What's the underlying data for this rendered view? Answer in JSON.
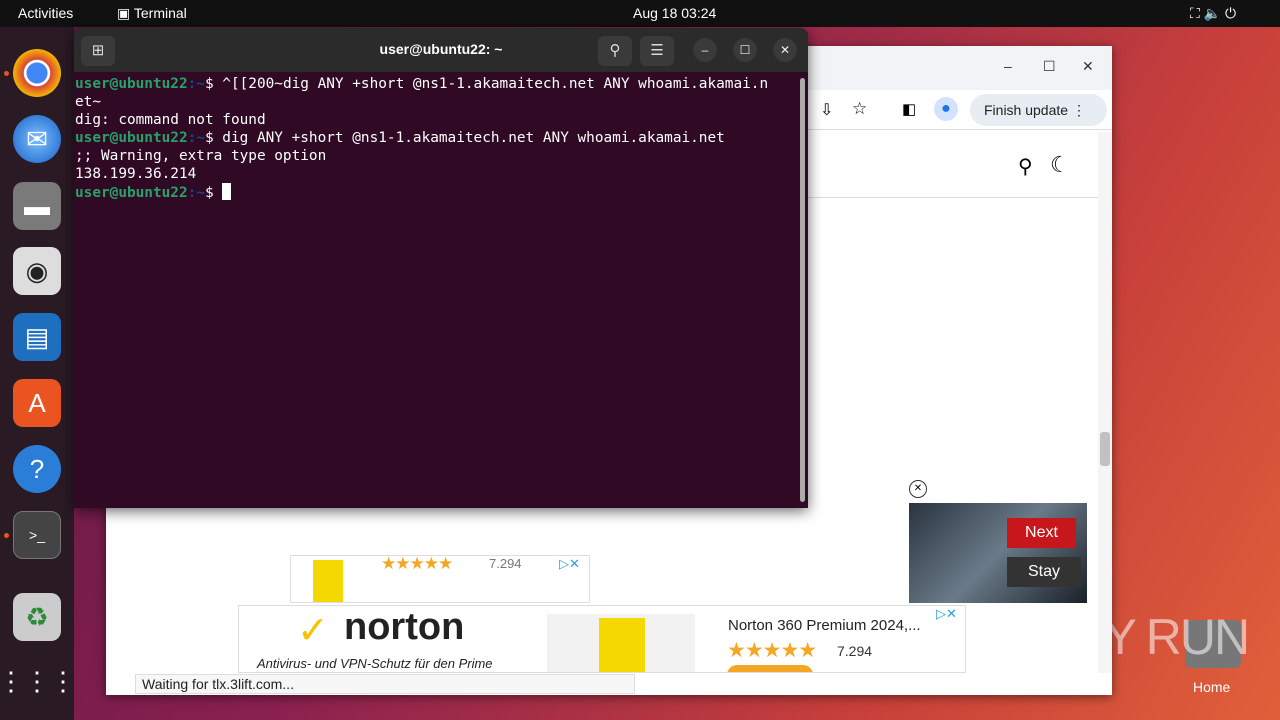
{
  "topbar": {
    "activities": "Activities",
    "app": "Terminal",
    "datetime": "Aug 18  03:24"
  },
  "dock": {
    "items": [
      "chrome-icon",
      "thunderbird-icon",
      "files-icon",
      "rhythmbox-icon",
      "writer-icon",
      "software-icon",
      "help-icon",
      "terminal-icon",
      "trash-icon",
      "apps-grid-icon"
    ]
  },
  "terminal": {
    "title": "user@ubuntu22: ~",
    "prompt_user": "user@ubuntu22",
    "prompt_path": ":~",
    "prompt_sign": "$ ",
    "lines": [
      {
        "type": "cmd",
        "text": "^[[200~dig ANY +short @ns1-1.akamaitech.net ANY whoami.akamai.n"
      },
      {
        "type": "out",
        "text": "et~"
      },
      {
        "type": "out",
        "text": "dig: command not found"
      },
      {
        "type": "cmd",
        "text": "dig ANY +short @ns1-1.akamaitech.net ANY whoami.akamai.net"
      },
      {
        "type": "out",
        "text": ";; Warning, extra type option"
      },
      {
        "type": "out",
        "text": "138.199.36.214"
      },
      {
        "type": "cmd",
        "text": ""
      }
    ]
  },
  "browser": {
    "finish_update": "Finish update",
    "status": "Waiting for tlx.3lift.com..."
  },
  "ads": {
    "rating": "7.294",
    "norton_brand": "norton",
    "norton_tagline": "Antivirus- und VPN-Schutz für den Prime",
    "norton_product": "Norton 360 Premium 2024,...",
    "video_next": "Next",
    "video_stay": "Stay"
  },
  "desktop": {
    "home_label": "Home",
    "watermark": "ANY RUN"
  },
  "colors": {
    "terminal_bg": "#300a24",
    "prompt_green": "#26a269",
    "accent": "#e95420"
  }
}
